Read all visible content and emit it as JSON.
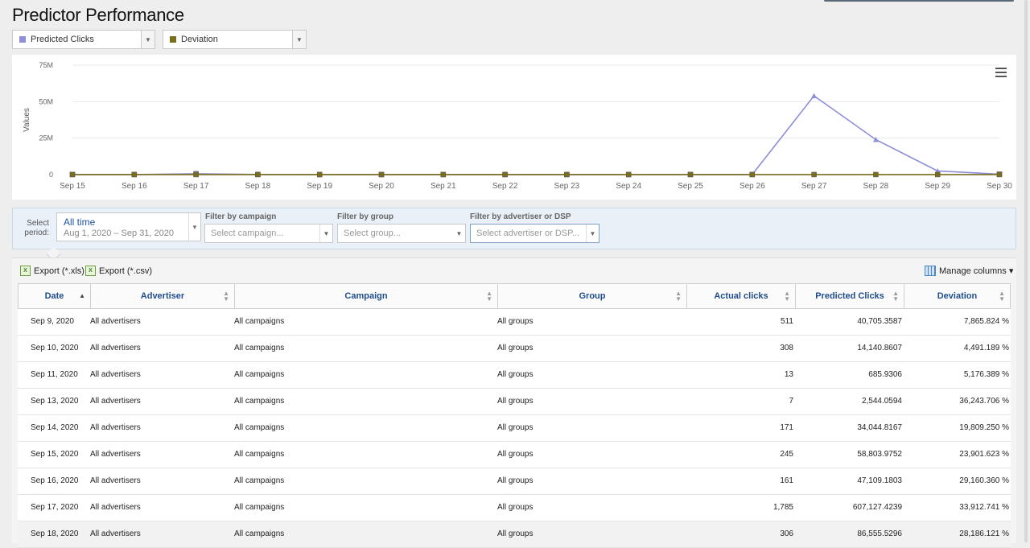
{
  "page": {
    "title": "Predictor Performance"
  },
  "metric_selectors": [
    {
      "label": "Predicted Clicks",
      "color": "#8e8fd8"
    },
    {
      "label": "Deviation",
      "color": "#7a6e1c"
    }
  ],
  "chart_data": {
    "type": "line",
    "ylabel": "Values",
    "ylim": [
      0,
      75000000
    ],
    "y_ticks": [
      {
        "value": 0,
        "label": "0"
      },
      {
        "value": 25000000,
        "label": "25M"
      },
      {
        "value": 50000000,
        "label": "50M"
      },
      {
        "value": 75000000,
        "label": "75M"
      }
    ],
    "categories": [
      "Sep 15",
      "Sep 16",
      "Sep 17",
      "Sep 18",
      "Sep 19",
      "Sep 20",
      "Sep 21",
      "Sep 22",
      "Sep 23",
      "Sep 24",
      "Sep 25",
      "Sep 26",
      "Sep 27",
      "Sep 28",
      "Sep 29",
      "Sep 30"
    ],
    "series": [
      {
        "name": "Predicted Clicks",
        "color": "#8e8fd8",
        "marker": "triangle",
        "values": [
          58804,
          47109,
          607127,
          86555,
          40000,
          35000,
          30000,
          45000,
          38000,
          42000,
          50000,
          60000,
          54000000,
          24000000,
          2500000,
          300000
        ]
      },
      {
        "name": "Deviation",
        "color": "#7a6e1c",
        "marker": "square",
        "values": [
          23901,
          29160,
          33912,
          28186,
          25000,
          24000,
          26000,
          27000,
          25500,
          24500,
          26500,
          27500,
          28000,
          29000,
          27000,
          26000
        ]
      }
    ],
    "grid": true,
    "legend": "none"
  },
  "filters": {
    "period_label": "Select period:",
    "period_value": "All time",
    "period_range": "Aug 1, 2020 – Sep 31, 2020",
    "campaign_label": "Filter by campaign",
    "campaign_placeholder": "Select campaign...",
    "group_label": "Filter by group",
    "group_placeholder": "Select group...",
    "advertiser_label": "Filter by advertiser or DSP",
    "advertiser_placeholder": "Select advertiser or DSP..."
  },
  "toolbar": {
    "export_xls": "Export (*.xls)",
    "export_csv": "Export (*.csv)",
    "manage_columns": "Manage columns ▾"
  },
  "table": {
    "columns": [
      "Date",
      "Advertiser",
      "Campaign",
      "Group",
      "Actual clicks",
      "Predicted Clicks",
      "Deviation"
    ],
    "rows": [
      [
        "Sep 9, 2020",
        "All advertisers",
        "All campaigns",
        "All groups",
        "511",
        "40,705.3587",
        "7,865.824 %"
      ],
      [
        "Sep 10, 2020",
        "All advertisers",
        "All campaigns",
        "All groups",
        "308",
        "14,140.8607",
        "4,491.189 %"
      ],
      [
        "Sep 11, 2020",
        "All advertisers",
        "All campaigns",
        "All groups",
        "13",
        "685.9306",
        "5,176.389 %"
      ],
      [
        "Sep 13, 2020",
        "All advertisers",
        "All campaigns",
        "All groups",
        "7",
        "2,544.0594",
        "36,243.706 %"
      ],
      [
        "Sep 14, 2020",
        "All advertisers",
        "All campaigns",
        "All groups",
        "171",
        "34,044.8167",
        "19,809.250 %"
      ],
      [
        "Sep 15, 2020",
        "All advertisers",
        "All campaigns",
        "All groups",
        "245",
        "58,803.9752",
        "23,901.623 %"
      ],
      [
        "Sep 16, 2020",
        "All advertisers",
        "All campaigns",
        "All groups",
        "161",
        "47,109.1803",
        "29,160.360 %"
      ],
      [
        "Sep 17, 2020",
        "All advertisers",
        "All campaigns",
        "All groups",
        "1,785",
        "607,127.4239",
        "33,912.741 %"
      ],
      [
        "Sep 18, 2020",
        "All advertisers",
        "All campaigns",
        "All groups",
        "306",
        "86,555.5296",
        "28,186.121 %"
      ]
    ]
  }
}
